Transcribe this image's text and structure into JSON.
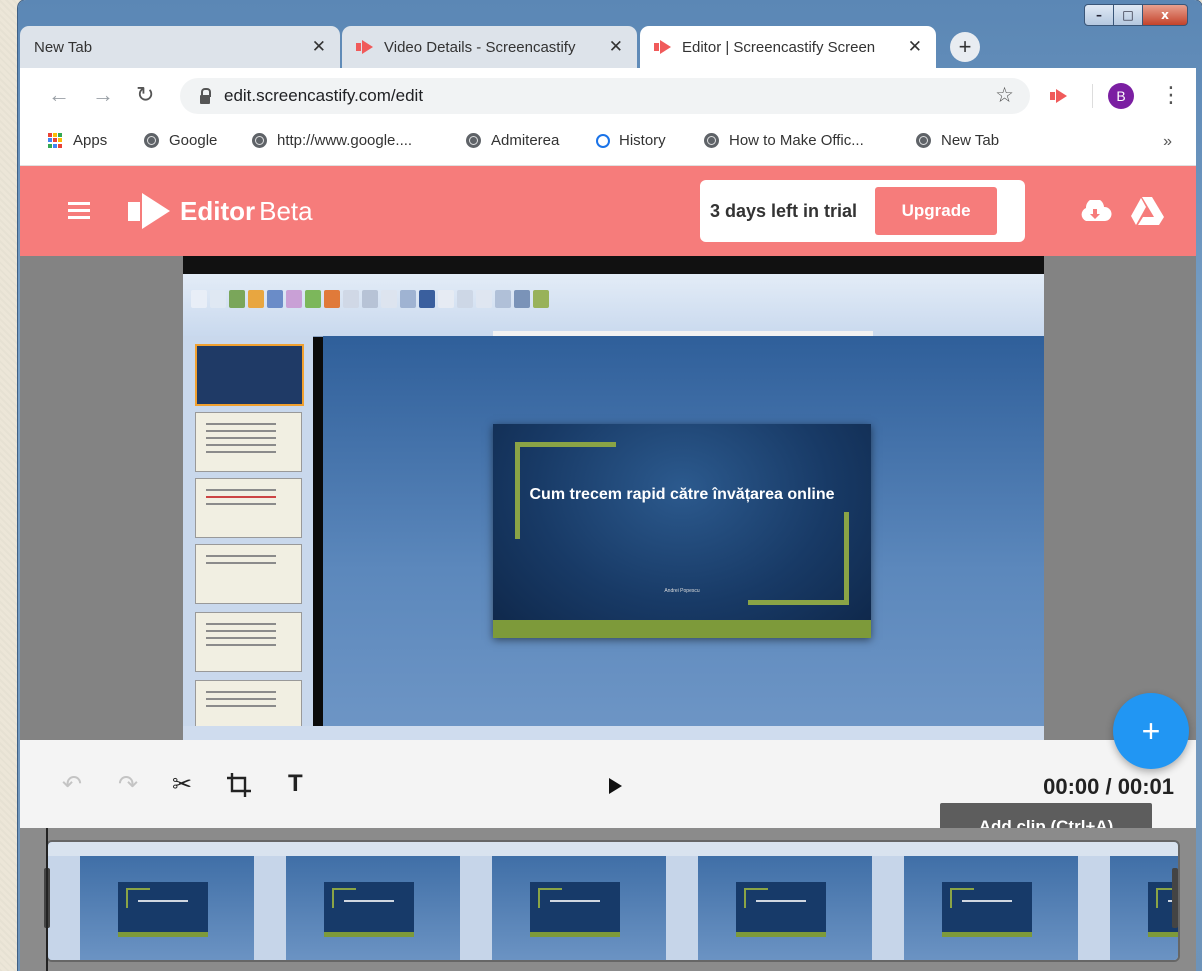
{
  "browser": {
    "tabs": [
      {
        "label": "New Tab",
        "active": false,
        "icon": "none"
      },
      {
        "label": "Video Details - Screencastify",
        "active": false,
        "icon": "screencastify-icon"
      },
      {
        "label": "Editor | Screencastify Screen",
        "active": true,
        "icon": "screencastify-icon"
      }
    ],
    "close_glyph": "✕",
    "new_tab_glyph": "+",
    "url": "edit.screencastify.com/edit",
    "profile_initial": "B",
    "bookmarks": [
      {
        "label": "Apps",
        "icon": "apps-grid-icon"
      },
      {
        "label": "Google",
        "icon": "globe-icon"
      },
      {
        "label": "http://www.google....",
        "icon": "globe-icon"
      },
      {
        "label": "Admiterea",
        "icon": "globe-icon"
      },
      {
        "label": "History",
        "icon": "history-icon"
      },
      {
        "label": "How to Make Offic...",
        "icon": "globe-icon"
      },
      {
        "label": "New Tab",
        "icon": "globe-icon"
      }
    ],
    "bookmarks_overflow": "»",
    "window_controls": {
      "minimize": "–",
      "maximize": "□",
      "close": "x"
    }
  },
  "app": {
    "name": "Editor",
    "badge": "Beta",
    "trial_text": "3 days left in trial",
    "upgrade_label": "Upgrade",
    "accent_color": "#f67c7b"
  },
  "video": {
    "slide_title": "Cum trecem rapid către învățarea online",
    "slide_author": "Andrei Popescu"
  },
  "controls": {
    "text_tool": "T",
    "time": "00:00 / 00:01",
    "add_clip_glyph": "+",
    "tooltip": "Add clip (Ctrl+A)"
  }
}
